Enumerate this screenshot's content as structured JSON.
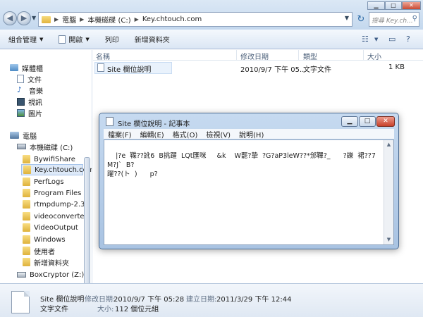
{
  "explorer": {
    "breadcrumbs": [
      "電腦",
      "本機磁碟 (C:)",
      "Key.chtouch.com"
    ],
    "search_placeholder": "搜尋 Key.ch...",
    "toolbar": {
      "organize": "組合管理",
      "open": "開啟",
      "print": "列印",
      "new_folder": "新增資料夾"
    },
    "columns": [
      "名稱",
      "修改日期",
      "類型",
      "大小"
    ],
    "file": {
      "name": "Site 欄位說明",
      "modified": "2010/9/7 下午 05...",
      "type": "文字文件",
      "size": "1 KB"
    },
    "nav": {
      "libraries": "媒體櫃",
      "documents": "文件",
      "music": "音樂",
      "videos": "視訊",
      "pictures": "圖片",
      "computer": "電腦",
      "drive_c": "本機磁碟 (C:)",
      "folders": [
        "BywifiShare",
        "Key.chtouch.com",
        "PerfLogs",
        "Program Files",
        "rtmpdump-2.3",
        "videoconverter",
        "VideoOutput",
        "Windows",
        "使用者",
        "新增資料夾"
      ],
      "drive_z": "BoxCryptor (Z:)"
    },
    "details": {
      "name": "Site 欄位說明",
      "type": "文字文件",
      "modified_label": "修改日期:",
      "modified": "2010/9/7 下午 05:28",
      "created_label": "建立日期:",
      "created": "2011/3/29 下午 12:44",
      "size_label": "大小:",
      "size": "112 個位元組"
    }
  },
  "notepad": {
    "title": "Site 欄位說明 - 記事本",
    "menu": [
      "檔案(F)",
      "編輯(E)",
      "格式(O)",
      "檢視(V)",
      "說明(H)"
    ],
    "content": "|?e  鞢??訛6  B挑躍  LQt匯咪     &k    W罷?挚  ?G?aP3leW??*邠鞸?_      ?鑠  裙??7M?J`  B?\n躍??(ト  )      p?"
  }
}
